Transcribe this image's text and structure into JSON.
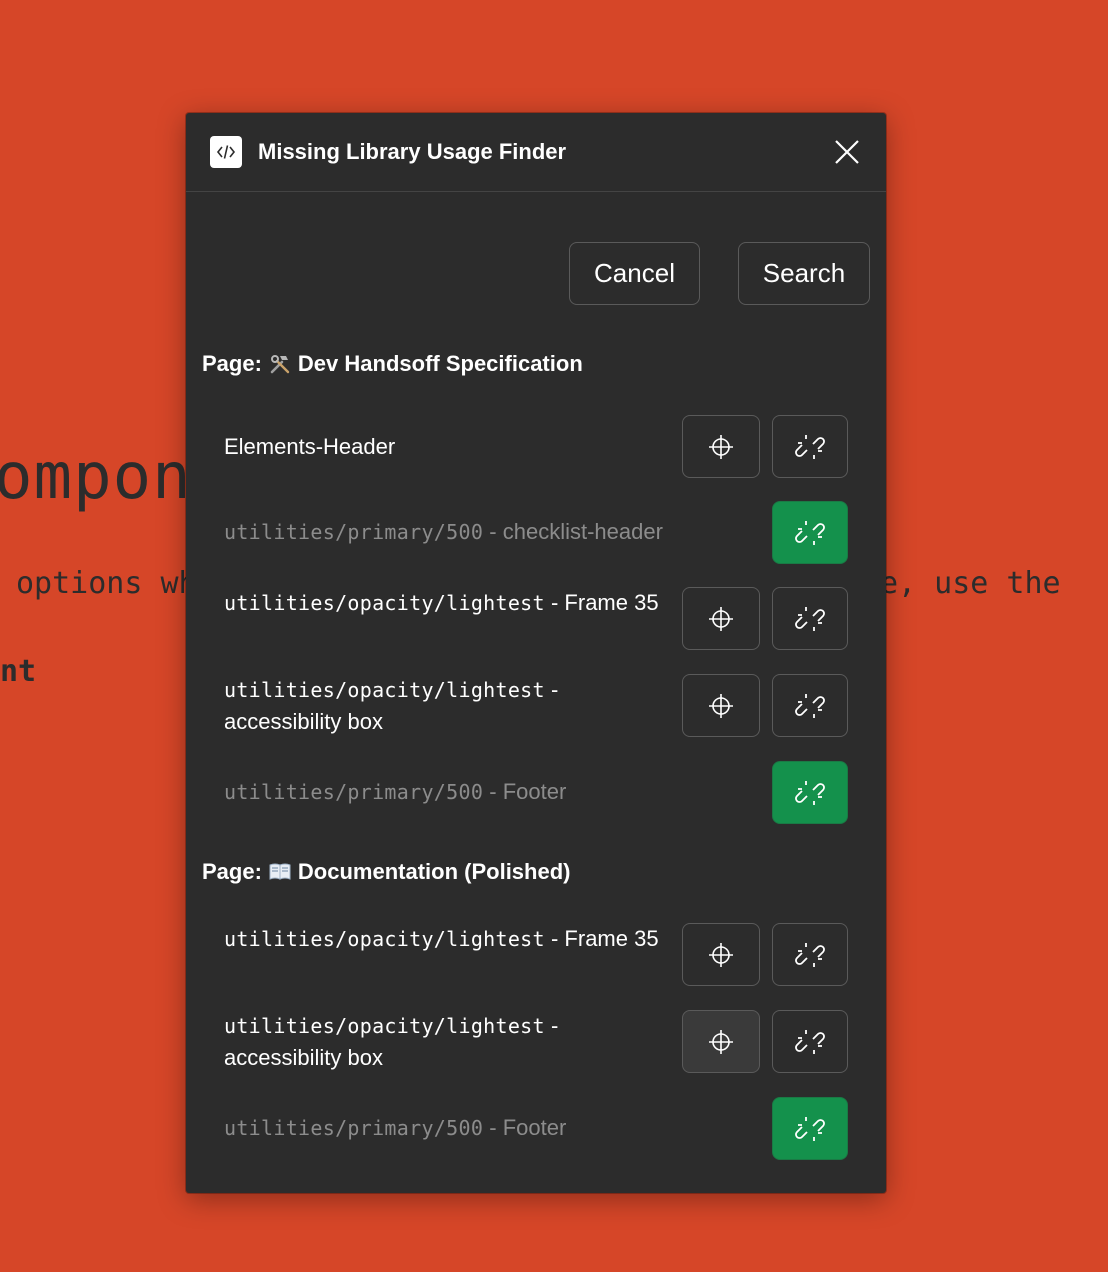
{
  "background": {
    "heading": "ompone",
    "para_left": "options wh",
    "para_right": "e, use the",
    "bold_fragment": "nt"
  },
  "modal": {
    "title": "Missing Library Usage Finder",
    "icon": "code-brackets-icon",
    "close_icon": "close-icon"
  },
  "actions": {
    "cancel_label": "Cancel",
    "search_label": "Search"
  },
  "sections": [
    {
      "page_prefix": "Page:",
      "page_emoji": "hammer-and-wrench-icon",
      "page_name": "Dev Handsoff Specification",
      "rows": [
        {
          "mono": "",
          "text": "Elements-Header",
          "state": "active"
        },
        {
          "mono": "utilities/primary/500",
          "text": " - checklist-header",
          "state": "relinked"
        },
        {
          "mono": "utilities/opacity/lightest",
          "text": " - Frame 35",
          "state": "active"
        },
        {
          "mono": "utilities/opacity/lightest",
          "text": " - accessibility box",
          "state": "active"
        },
        {
          "mono": "utilities/primary/500",
          "text": " - Footer",
          "state": "relinked"
        }
      ]
    },
    {
      "page_prefix": "Page:",
      "page_emoji": "open-book-icon",
      "page_name": "Documentation (Polished)",
      "rows": [
        {
          "mono": "utilities/opacity/lightest",
          "text": " - Frame 35",
          "state": "active"
        },
        {
          "mono": "utilities/opacity/lightest",
          "text": " - accessibility box",
          "state": "active"
        },
        {
          "mono": "utilities/primary/500",
          "text": " - Footer",
          "state": "relinked"
        }
      ]
    }
  ],
  "colors": {
    "background": "#d64628",
    "panel": "#2c2c2c",
    "relinked": "#14914c",
    "dim_text": "#8c8c8c"
  }
}
